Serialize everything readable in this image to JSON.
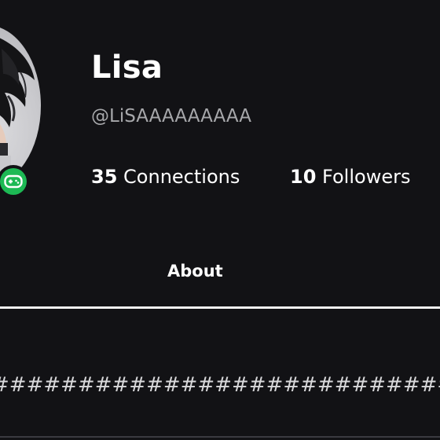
{
  "profile": {
    "display_name": "Lisa",
    "username": "@LiSAAAAAAAAA",
    "avatar_icon": "user-avatar",
    "presence_icon": "gamepad-icon",
    "presence_color": "#1db954"
  },
  "stats": {
    "connections_count": "35",
    "connections_label": "Connections",
    "followers_count": "10",
    "followers_label": "Followers"
  },
  "tabs": {
    "about_label": "About"
  },
  "about": {
    "text": "########################################"
  },
  "colors": {
    "background": "#121215",
    "text_primary": "#ffffff",
    "text_secondary": "#a7a8ab"
  }
}
